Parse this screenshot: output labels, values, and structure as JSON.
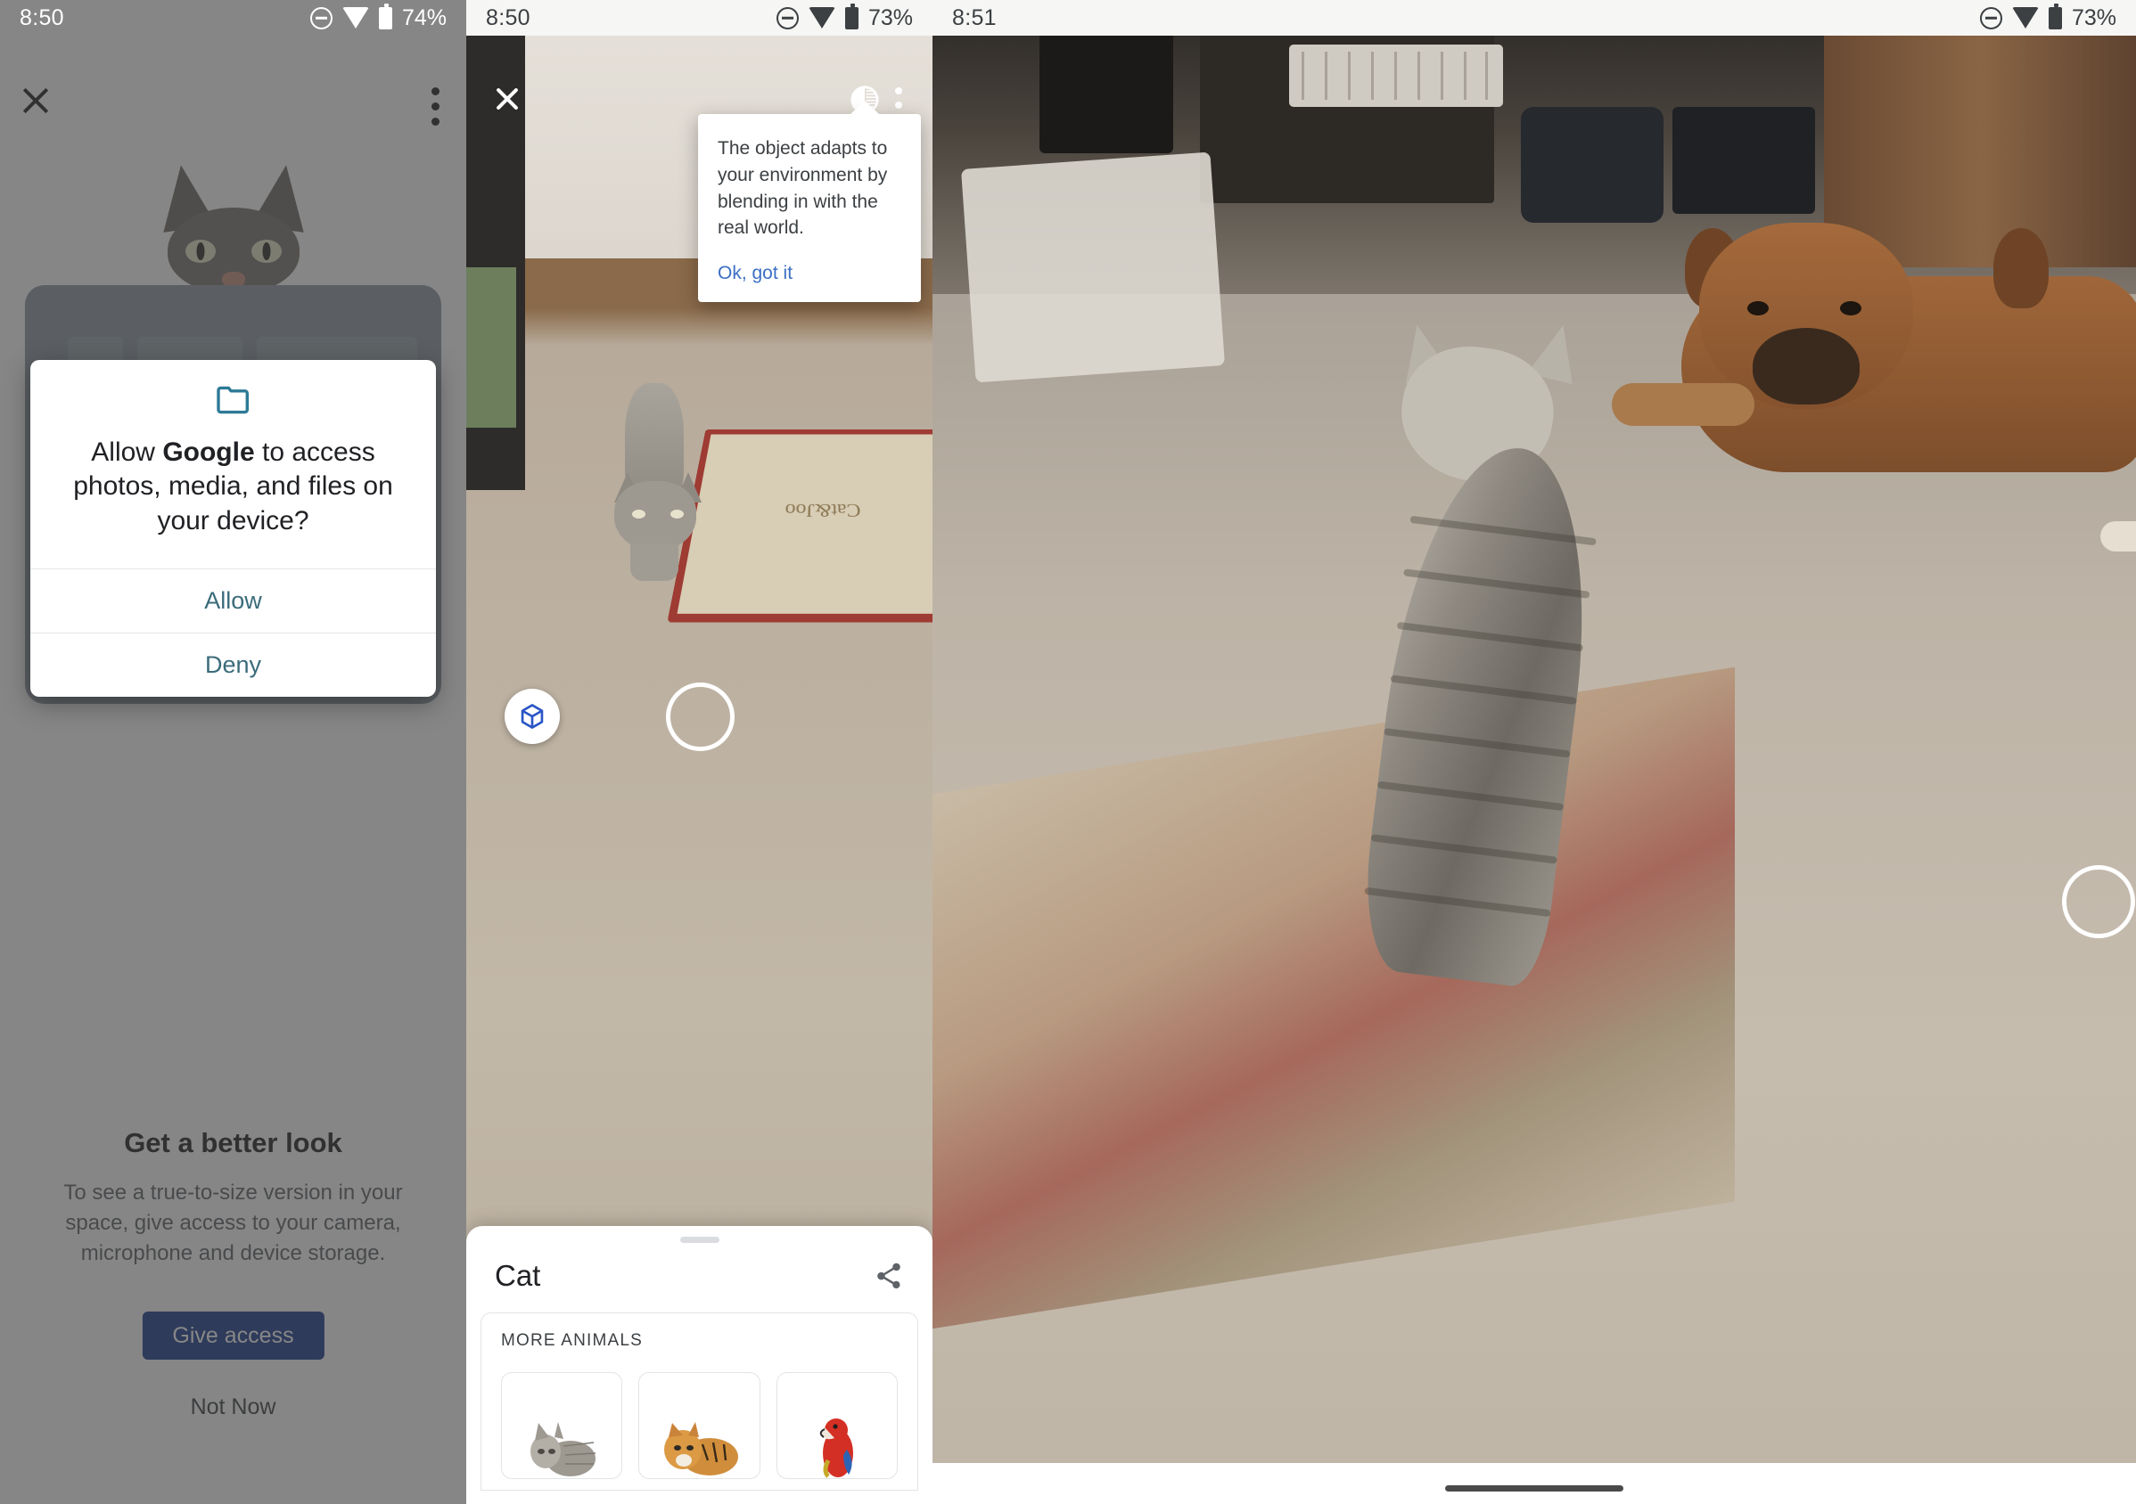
{
  "panel1": {
    "statusbar": {
      "time": "8:50",
      "battery": "74%",
      "dnd_icon": "do-not-disturb-icon",
      "wifi_icon": "wifi-icon",
      "battery_icon": "battery-icon"
    },
    "close_icon": "close-icon",
    "overflow_icon": "overflow-menu-icon",
    "heading": "Get a better look",
    "subtext": "To see a true-to-size version in your space, give access to your camera, microphone and device storage.",
    "cta_label": "Give access",
    "secondary_label": "Not Now",
    "dialog": {
      "folder_icon": "folder-icon",
      "title_prefix": "Allow ",
      "title_bold": "Google",
      "title_suffix": " to access photos, media, and files on your device?",
      "allow_label": "Allow",
      "deny_label": "Deny",
      "accent_color": "#3a6b7a",
      "icon_color": "#2d7a96"
    }
  },
  "panel2": {
    "statusbar": {
      "time": "8:50",
      "battery": "73%"
    },
    "close_icon": "close-icon",
    "contrast_icon": "contrast-icon",
    "overflow_icon": "overflow-menu-icon",
    "tooltip": {
      "text": "The object adapts to your environment by blending in with the real world.",
      "cta_label": "Ok, got it",
      "cta_color": "#3b6fc4"
    },
    "cube_button_icon": "3d-cube-icon",
    "cube_color": "#2a56c6",
    "shutter_icon": "shutter-button",
    "sheet": {
      "grab_handle": "drag-handle",
      "title": "Cat",
      "share_icon": "share-icon",
      "section_label": "MORE ANIMALS",
      "chips": [
        {
          "name": "cat-thumbnail"
        },
        {
          "name": "tiger-thumbnail"
        },
        {
          "name": "parrot-thumbnail"
        }
      ]
    }
  },
  "panel3": {
    "statusbar": {
      "time": "8:51",
      "battery": "73%"
    },
    "shutter_icon": "shutter-button",
    "scene_note": "AR cat placed in living room with real dog on carpet"
  }
}
